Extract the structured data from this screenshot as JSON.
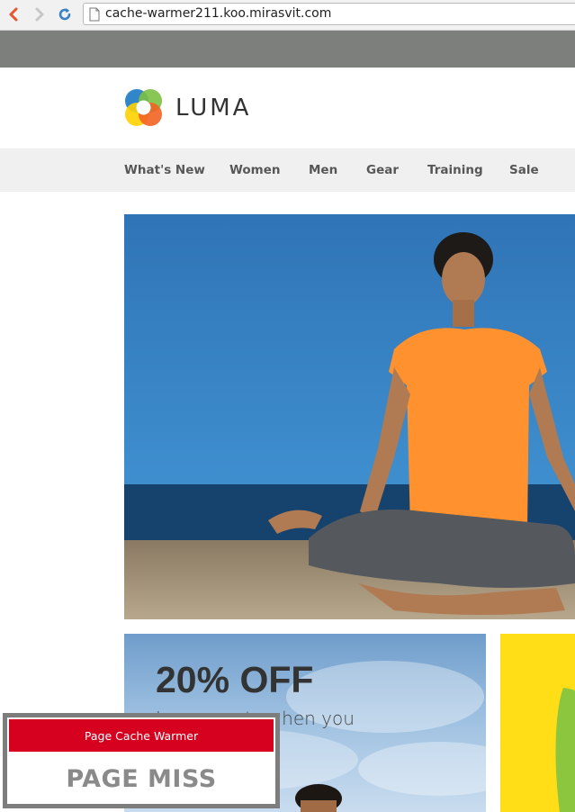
{
  "browser": {
    "url": "cache-warmer211.koo.mirasvit.com",
    "icons": {
      "back": "back-arrow-icon",
      "forward": "forward-arrow-icon",
      "reload": "reload-icon",
      "page": "document-icon"
    }
  },
  "header": {
    "logo_text": "LUMA",
    "logo_colors": [
      "#f26322",
      "#1979c3",
      "#7bc043",
      "#ffd100"
    ]
  },
  "nav": {
    "items": [
      "What's New",
      "Women",
      "Men",
      "Gear",
      "Training",
      "Sale"
    ]
  },
  "promo": {
    "title": "20% OFF",
    "subtitle": "Luma pants when you"
  },
  "cache_warmer": {
    "title": "Page Cache Warmer",
    "status": "PAGE MISS",
    "header_color": "#d6011e"
  }
}
